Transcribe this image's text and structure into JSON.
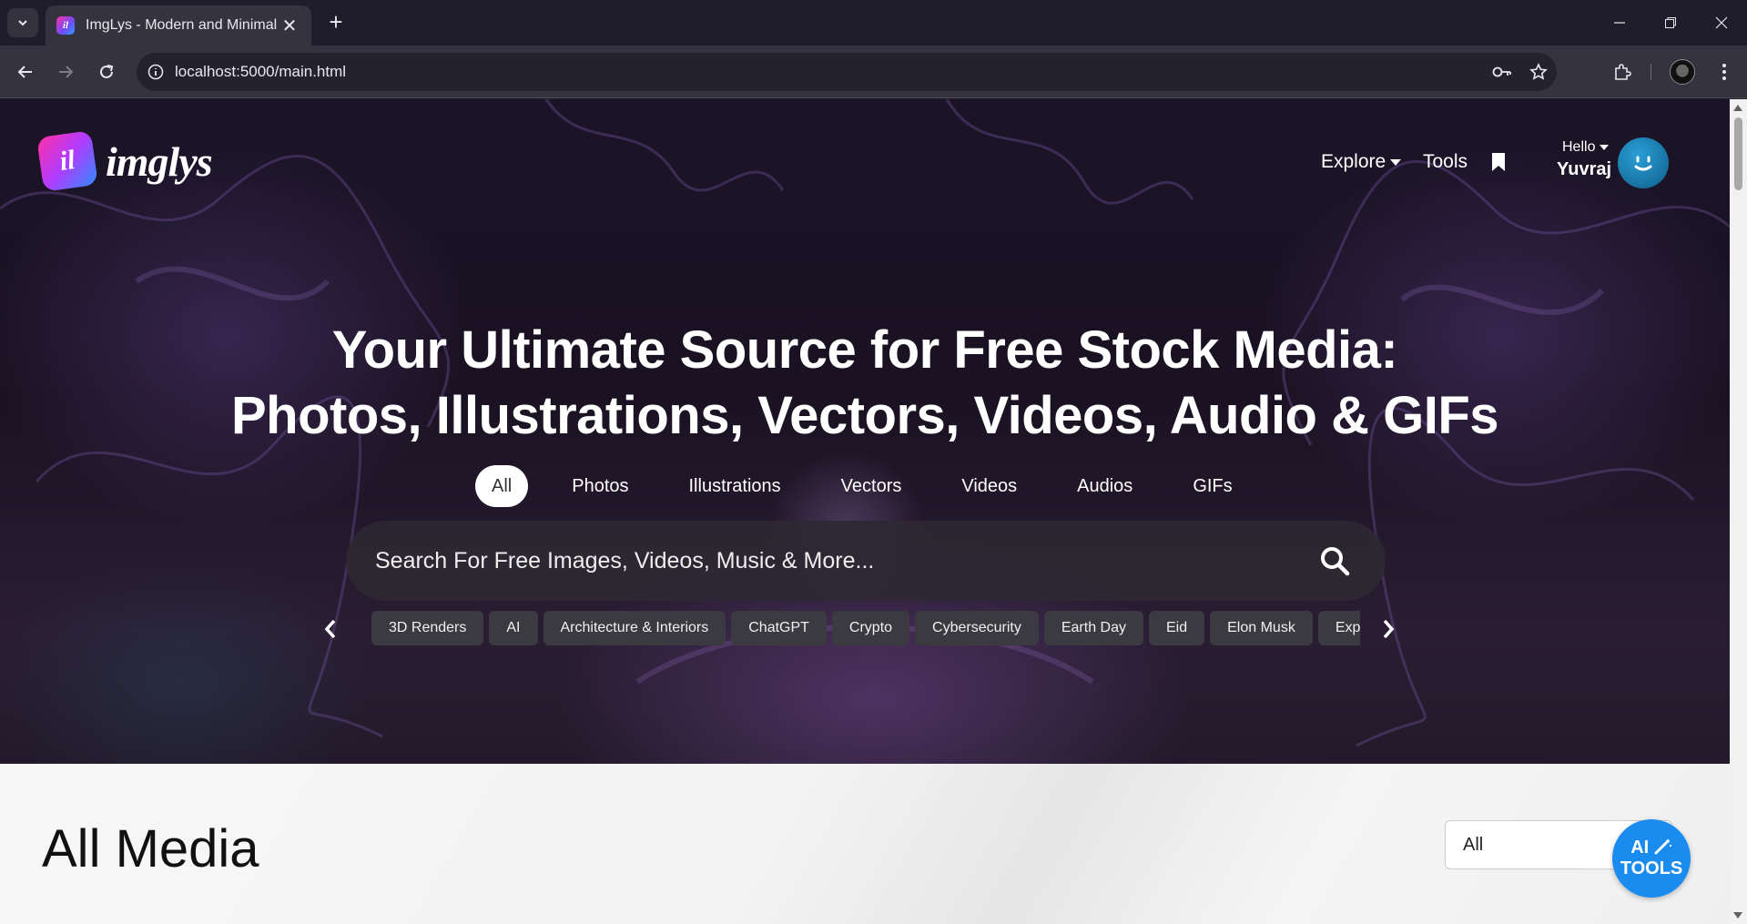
{
  "browser": {
    "tab_title": "ImgLys - Modern and Minimal",
    "url": "localhost:5000/main.html"
  },
  "site": {
    "logo_text": "imglys",
    "logo_mark": "il",
    "nav": {
      "explore": "Explore",
      "tools": "Tools"
    },
    "user": {
      "hello": "Hello",
      "name": "Yuvraj"
    }
  },
  "hero": {
    "headline_line1": "Your Ultimate Source for Free Stock Media:",
    "headline_line2": "Photos, Illustrations, Vectors, Videos, Audio & GIFs",
    "filters": [
      {
        "label": "All",
        "active": true
      },
      {
        "label": "Photos"
      },
      {
        "label": "Illustrations"
      },
      {
        "label": "Vectors"
      },
      {
        "label": "Videos"
      },
      {
        "label": "Audios"
      },
      {
        "label": "GIFs"
      }
    ],
    "search_placeholder": "Search For Free Images, Videos, Music & More...",
    "tags": [
      "3D Renders",
      "AI",
      "Architecture & Interiors",
      "ChatGPT",
      "Crypto",
      "Cybersecurity",
      "Earth Day",
      "Eid",
      "Elon Musk",
      "Experimental"
    ]
  },
  "section": {
    "title": "All Media",
    "select_value": "All",
    "ai_button_line1": "AI",
    "ai_button_line2": "TOOLS"
  },
  "colors": {
    "accent": "#1a8cf0",
    "hero_bg": "#1b1428",
    "tag_bg": "#3b3a40"
  }
}
